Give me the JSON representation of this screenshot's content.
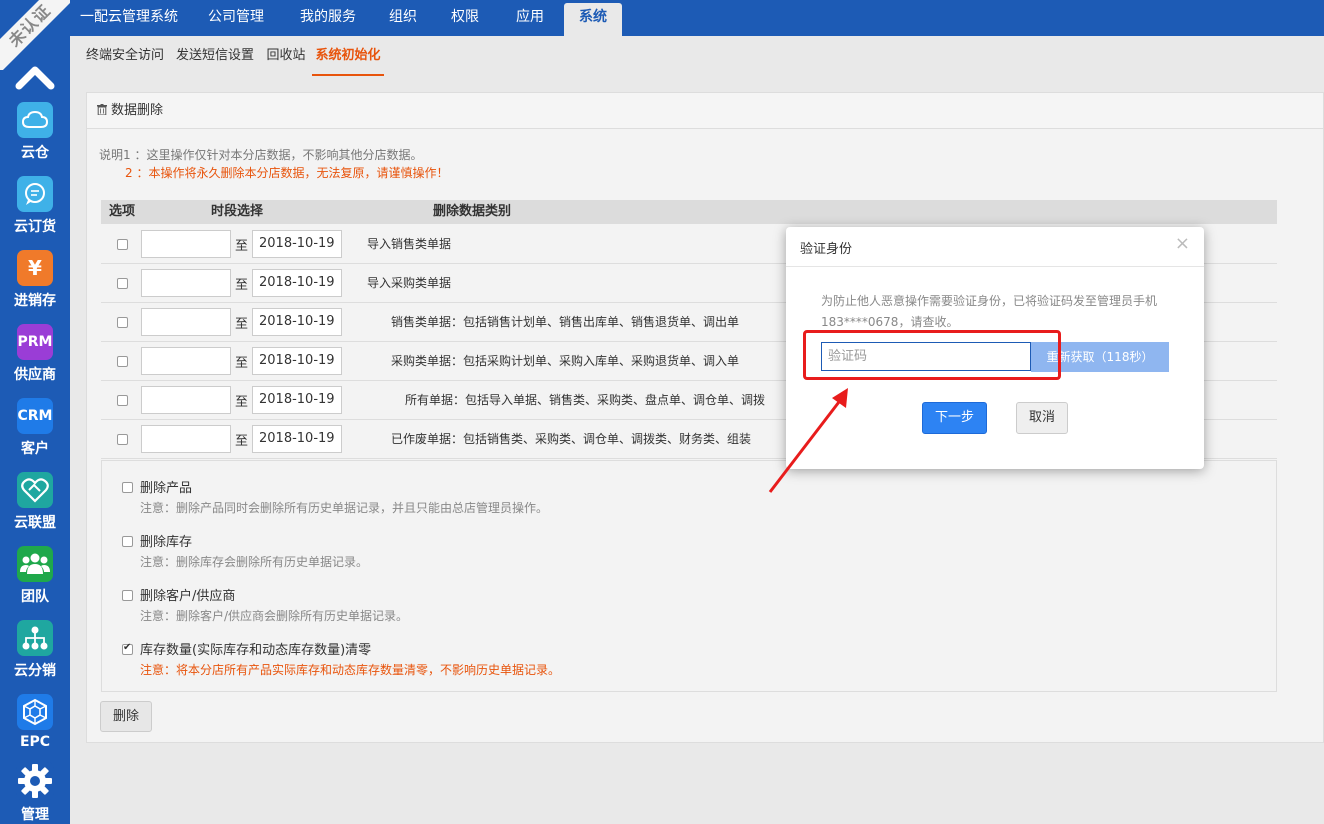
{
  "sidebar": {
    "badge": "未认证",
    "items": [
      {
        "label": "云仓",
        "icon": "cloud-icon",
        "color": "#3fb1e8"
      },
      {
        "label": "云订货",
        "icon": "chat-icon",
        "color": "#3fb1e8"
      },
      {
        "label": "进销存",
        "icon": "yen-icon",
        "color": "#f07a2a",
        "glyph": "¥"
      },
      {
        "label": "供应商",
        "icon": "prm-icon",
        "color": "#9a3dd6",
        "glyph": "PRM"
      },
      {
        "label": "客户",
        "icon": "crm-icon",
        "color": "#1f7be8",
        "glyph": "CRM"
      },
      {
        "label": "云联盟",
        "icon": "handshake-heart-icon",
        "color": "#1fa7a0"
      },
      {
        "label": "团队",
        "icon": "team-icon",
        "color": "#1fa84b"
      },
      {
        "label": "云分销",
        "icon": "network-icon",
        "color": "#1fa7a0"
      },
      {
        "label": "EPC",
        "icon": "cube-icon",
        "color": "#1f7be8"
      },
      {
        "label": "管理",
        "icon": "gear-icon",
        "color": "#1d5bb5"
      }
    ]
  },
  "topnav": {
    "items": [
      "一配云管理系统",
      "公司管理",
      "我的服务",
      "组织",
      "权限",
      "应用",
      "系统"
    ],
    "active": "系统"
  },
  "subnav": {
    "items": [
      "终端安全访问",
      "发送短信设置",
      "回收站",
      "系统初始化"
    ],
    "active": "系统初始化"
  },
  "panel": {
    "title": "数据删除",
    "note1": "说明1 ：这里操作仅针对本分店数据，不影响其他分店数据。",
    "note2": "2 ：本操作将永久删除本分店数据，无法复原，请谨慎操作！",
    "table": {
      "headers": [
        "选项",
        "时段选择",
        "删除数据类别"
      ],
      "to_label": "至",
      "rows": [
        {
          "date_to": "2018-10-19",
          "cat_name": "导入销售类单据",
          "cat_desc": ""
        },
        {
          "date_to": "2018-10-19",
          "cat_name": "导入采购类单据",
          "cat_desc": ""
        },
        {
          "date_to": "2018-10-19",
          "cat_name": "销售类单据",
          "cat_desc": "：包括销售计划单、销售出库单、销售退货单、调出单"
        },
        {
          "date_to": "2018-10-19",
          "cat_name": "采购类单据",
          "cat_desc": "：包括采购计划单、采购入库单、采购退货单、调入单"
        },
        {
          "date_to": "2018-10-19",
          "cat_name": "所有单据",
          "cat_desc": "：包括导入单据、销售类、采购类、盘点单、调仓单、调拨"
        },
        {
          "date_to": "2018-10-19",
          "cat_name": "已作废单据",
          "cat_desc": "：包括销售类、采购类、调仓单、调拨类、财务类、组装"
        }
      ]
    },
    "options": [
      {
        "title": "删除产品",
        "note": "注意：删除产品同时会删除所有历史单据记录，并且只能由总店管理员操作。",
        "checked": false,
        "warn": false
      },
      {
        "title": "删除库存",
        "note": "注意：删除库存会删除所有历史单据记录。",
        "checked": false,
        "warn": false
      },
      {
        "title": "删除客户/供应商",
        "note": "注意：删除客户/供应商会删除所有历史单据记录。",
        "checked": false,
        "warn": false
      },
      {
        "title": "库存数量(实际库存和动态库存数量)清零",
        "note": "注意：将本分店所有产品实际库存和动态库存数量清零，不影响历史单据记录。",
        "checked": true,
        "warn": true
      }
    ],
    "delete_label": "删除"
  },
  "modal": {
    "title": "验证身份",
    "close": "×",
    "message": "为防止他人恶意操作需要验证身份，已将验证码发至管理员手机183****0678，请查收。",
    "code_placeholder": "验证码",
    "resend_label": "重新获取（118秒）",
    "next_label": "下一步",
    "cancel_label": "取消"
  }
}
